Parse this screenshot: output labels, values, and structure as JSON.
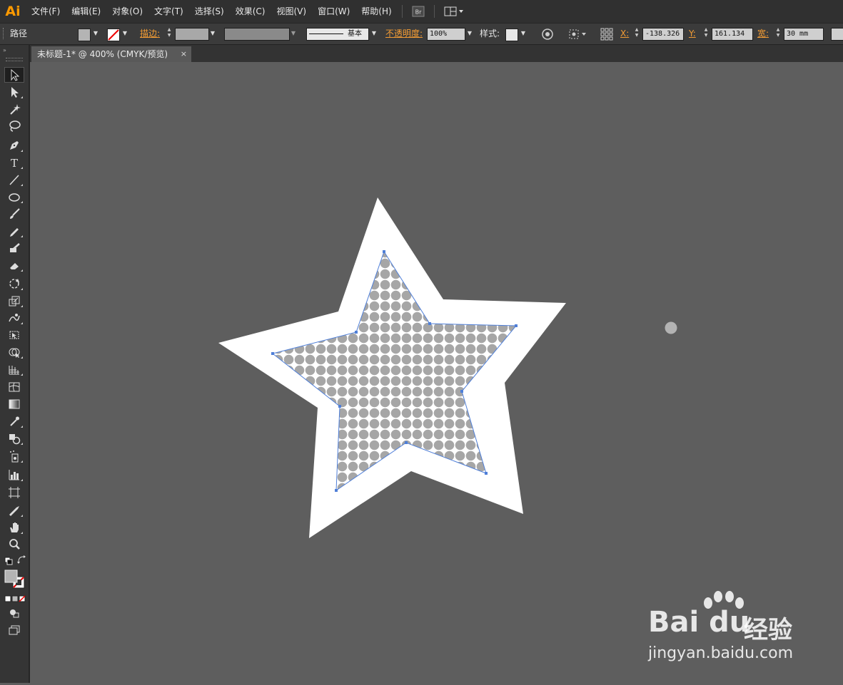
{
  "app": {
    "logo": "Ai"
  },
  "menu": {
    "items": [
      "文件(F)",
      "编辑(E)",
      "对象(O)",
      "文字(T)",
      "选择(S)",
      "效果(C)",
      "视图(V)",
      "窗口(W)",
      "帮助(H)"
    ],
    "bridge_label": "Br"
  },
  "control": {
    "object_type": "路径",
    "stroke_label": "描边:",
    "stroke_profile": "基本",
    "opacity_label": "不透明度:",
    "opacity_value": "100%",
    "style_label": "样式:",
    "x_label": "X:",
    "x_value": "-138.326",
    "y_label": "Y:",
    "y_value": "161.134",
    "w_label": "宽:",
    "w_value": "30 mm",
    "fill_color": "#b4b4b4",
    "accent": "#f39c34"
  },
  "document": {
    "tab_title": "未标题-1* @ 400% (CMYK/预览)",
    "tab_close": "×"
  },
  "artwork": {
    "star_color": "#ffffff",
    "pattern_dot_color": "#a6a6a6",
    "selection_color": "#4f7fd8"
  },
  "watermark": {
    "brand": "Bai du",
    "brand_cn": "经验",
    "url": "jingyan.baidu.com"
  }
}
